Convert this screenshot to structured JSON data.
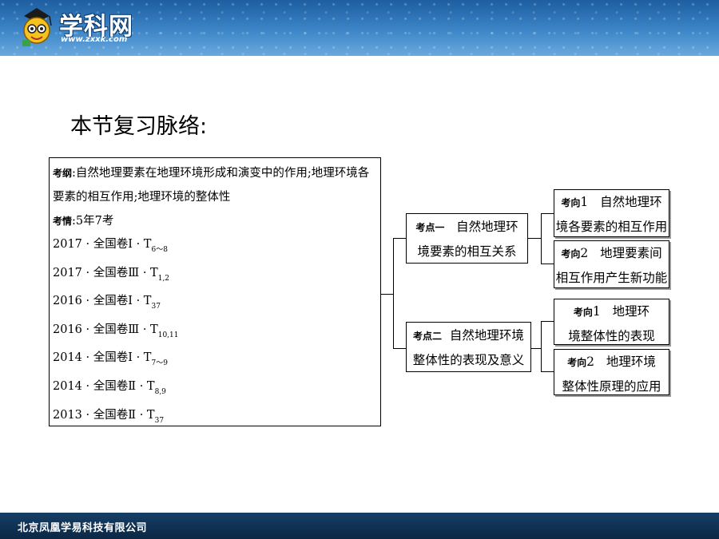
{
  "header": {
    "logo_title": "学科网",
    "logo_url": "www.zxxk.com"
  },
  "page_title": "本节复习脉络:",
  "left_panel": {
    "syllabus_label": "考纲",
    "syllabus_text": ":自然地理要素在地理环境形成和演变中的作用;地理环境各要素的相互作用;地理环境的整体性",
    "exam_label": "考情",
    "exam_text": ":5年7考",
    "exams": [
      {
        "text": "2017 · 全国卷Ⅰ · T",
        "sub": "6～8"
      },
      {
        "text": "2017 · 全国卷Ⅲ · T",
        "sub": "1,2"
      },
      {
        "text": "2016 · 全国卷Ⅰ · T",
        "sub": "37"
      },
      {
        "text": "2016 · 全国卷Ⅲ · T",
        "sub": "10,11"
      },
      {
        "text": "2014 · 全国卷Ⅰ · T",
        "sub": "7～9"
      },
      {
        "text": "2014 · 全国卷Ⅱ · T",
        "sub": "8,9"
      },
      {
        "text": "2013 · 全国卷Ⅱ · T",
        "sub": "37"
      }
    ]
  },
  "points": [
    {
      "label": "考点一",
      "line1": "自然地理环",
      "line2": "境要素的相互关系"
    },
    {
      "label": "考点二",
      "line1": "自然地理环境",
      "line2": "整体性的表现及意义"
    }
  ],
  "directions": [
    {
      "label": "考向",
      "num": "1",
      "line1": "自然地理环",
      "line2": "境各要素的相互作用"
    },
    {
      "label": "考向",
      "num": "2",
      "line1": "地理要素间",
      "line2": "相互作用产生新功能"
    },
    {
      "label": "考向",
      "num": "1",
      "line1": "地理环",
      "line2": "境整体性的表现"
    },
    {
      "label": "考向",
      "num": "2",
      "line1": "地理环境",
      "line2": "整体性原理的应用"
    }
  ],
  "footer": {
    "company": "北京凤凰学易科技有限公司"
  },
  "colors": {
    "header_blue": "#3d86c8",
    "footer_navy": "#0b2744"
  }
}
